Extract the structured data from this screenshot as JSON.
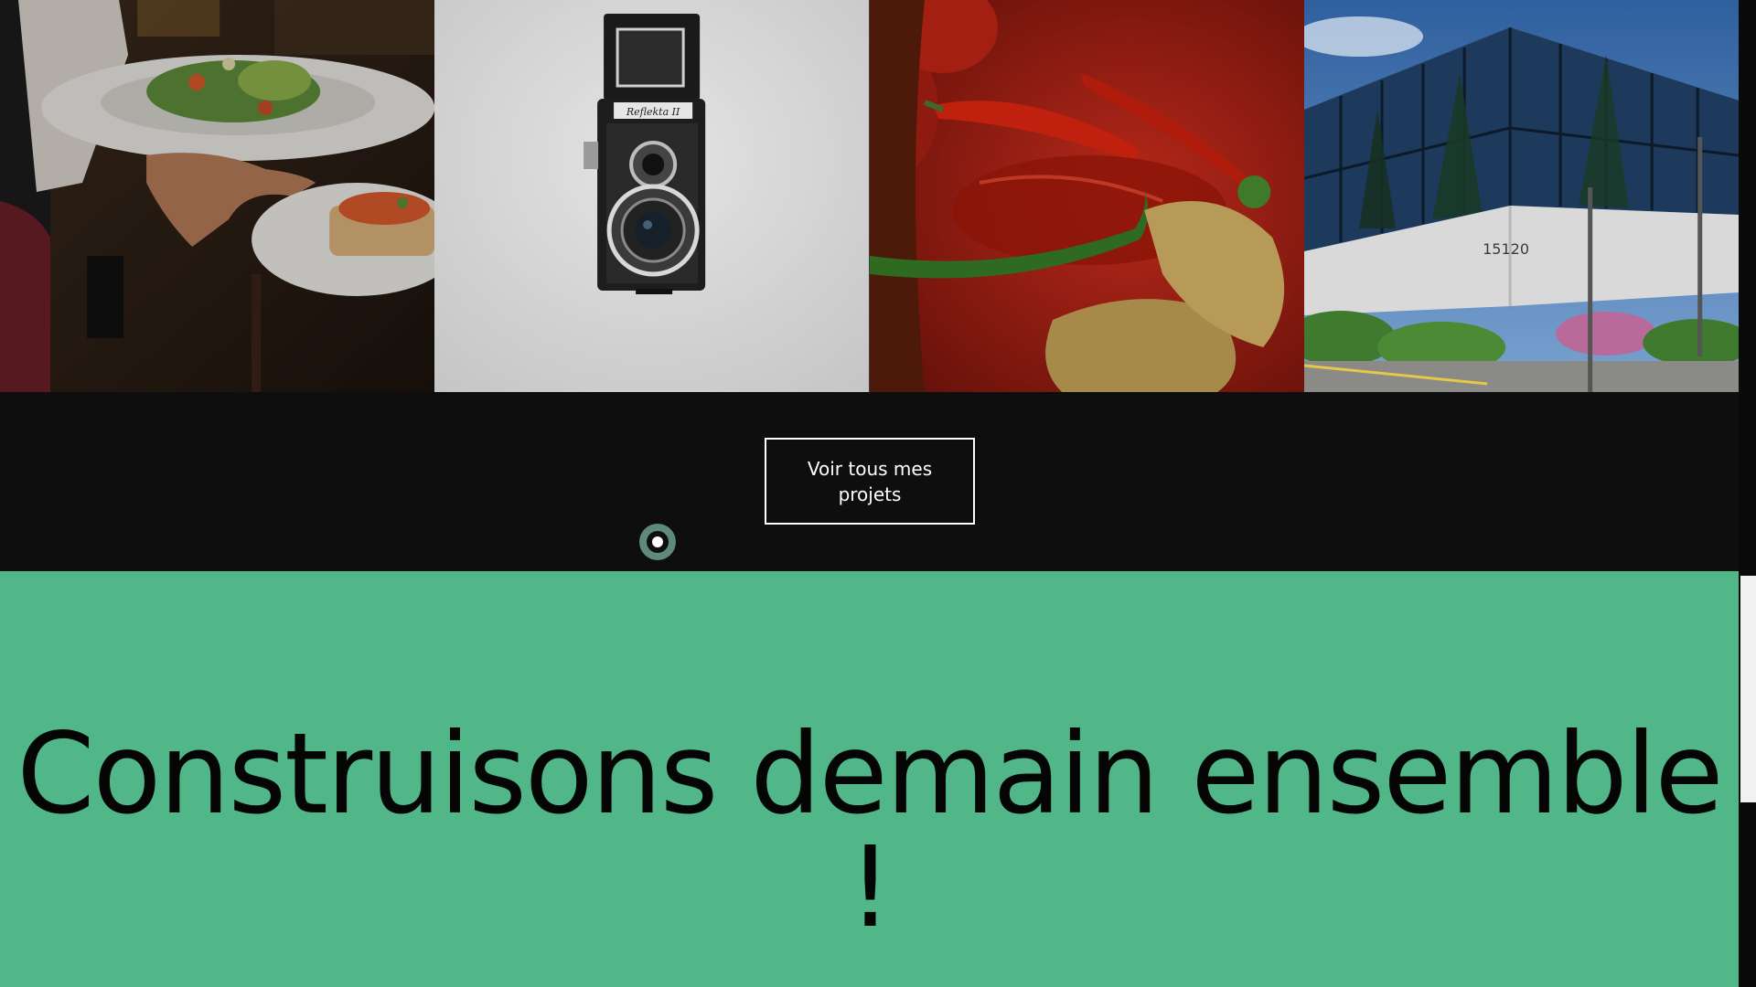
{
  "gallery": {
    "tiles": [
      {
        "name": "restaurant-project-image",
        "alt": "Serveur portant des assiettes de salade"
      },
      {
        "name": "camera-project-image",
        "alt": "Appareil photo Reflekta II"
      },
      {
        "name": "food-project-image",
        "alt": "Piments rouges et verts"
      },
      {
        "name": "building-project-image",
        "alt": "Immeuble de bureaux 15120"
      }
    ],
    "camera_brand": "Reflekta II",
    "building_number": "15120"
  },
  "cta": {
    "button_label": "Voir tous mes projets"
  },
  "hero": {
    "headline": "Construisons demain ensemble !"
  },
  "colors": {
    "dark_background": "#0e0e0e",
    "accent_green": "#52b788",
    "cursor_ring": "#5e8a7b"
  }
}
